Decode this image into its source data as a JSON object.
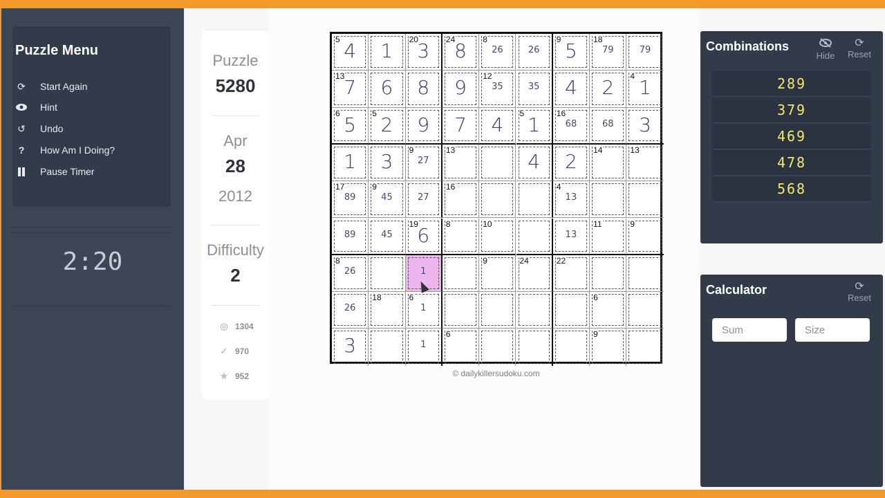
{
  "menu": {
    "title": "Puzzle Menu",
    "items": [
      {
        "label": "Start Again",
        "icon": "refresh-icon"
      },
      {
        "label": "Hint",
        "icon": "eye-icon"
      },
      {
        "label": "Undo",
        "icon": "undo-icon"
      },
      {
        "label": "How Am I Doing?",
        "icon": "question-icon"
      },
      {
        "label": "Pause Timer",
        "icon": "pause-icon"
      }
    ]
  },
  "timer": "2:20",
  "info": {
    "puzzle_label": "Puzzle",
    "puzzle_number": "5280",
    "month": "Apr",
    "day": "28",
    "year": "2012",
    "difficulty_label": "Difficulty",
    "difficulty": "2",
    "stats": [
      {
        "icon": "target-icon",
        "value": "1304"
      },
      {
        "icon": "check-icon",
        "value": "970"
      },
      {
        "icon": "star-icon",
        "value": "952"
      }
    ]
  },
  "grid": {
    "rows": [
      [
        "4",
        "1",
        "3",
        "8",
        "26",
        "26",
        "5",
        "79",
        "79"
      ],
      [
        "7",
        "6",
        "8",
        "9",
        "35",
        "35",
        "4",
        "2",
        "1"
      ],
      [
        "5",
        "2",
        "9",
        "7",
        "4",
        "1",
        "68",
        "68",
        "3"
      ],
      [
        "1",
        "3",
        "27",
        "",
        "",
        "4",
        "2",
        "",
        ""
      ],
      [
        "89",
        "45",
        "27",
        "",
        "",
        "",
        "13",
        "",
        ""
      ],
      [
        "89",
        "45",
        "6",
        "",
        "",
        "",
        "13",
        "",
        ""
      ],
      [
        "26",
        "",
        "1",
        "",
        "",
        "",
        "",
        "",
        ""
      ],
      [
        "26",
        "",
        "1",
        "",
        "",
        "",
        "",
        "",
        ""
      ],
      [
        "3",
        "",
        "1",
        "",
        "",
        "",
        "",
        "",
        ""
      ]
    ],
    "candidate_cells": [
      "0,4",
      "0,5",
      "0,7",
      "0,8",
      "1,4",
      "1,5",
      "2,6",
      "2,7",
      "3,2",
      "4,0",
      "4,1",
      "4,2",
      "4,6",
      "5,0",
      "5,1",
      "5,6",
      "6,0",
      "6,2",
      "7,0",
      "7,2",
      "8,2"
    ],
    "cage_sums": [
      {
        "cell": "0,0",
        "sum": "5"
      },
      {
        "cell": "0,2",
        "sum": "20"
      },
      {
        "cell": "0,3",
        "sum": "24"
      },
      {
        "cell": "0,4",
        "sum": "8"
      },
      {
        "cell": "0,6",
        "sum": "9"
      },
      {
        "cell": "0,7",
        "sum": "18"
      },
      {
        "cell": "1,0",
        "sum": "13"
      },
      {
        "cell": "1,4",
        "sum": "12"
      },
      {
        "cell": "1,8",
        "sum": "4"
      },
      {
        "cell": "2,0",
        "sum": "6"
      },
      {
        "cell": "2,1",
        "sum": "5"
      },
      {
        "cell": "2,5",
        "sum": "5"
      },
      {
        "cell": "2,6",
        "sum": "16"
      },
      {
        "cell": "3,2",
        "sum": "9"
      },
      {
        "cell": "3,3",
        "sum": "13"
      },
      {
        "cell": "3,7",
        "sum": "14"
      },
      {
        "cell": "3,8",
        "sum": "13"
      },
      {
        "cell": "4,0",
        "sum": "17"
      },
      {
        "cell": "4,1",
        "sum": "9"
      },
      {
        "cell": "4,3",
        "sum": "16"
      },
      {
        "cell": "4,6",
        "sum": "4"
      },
      {
        "cell": "5,2",
        "sum": "19"
      },
      {
        "cell": "5,3",
        "sum": "8"
      },
      {
        "cell": "5,4",
        "sum": "10"
      },
      {
        "cell": "5,7",
        "sum": "11"
      },
      {
        "cell": "5,8",
        "sum": "9"
      },
      {
        "cell": "6,0",
        "sum": "8"
      },
      {
        "cell": "6,4",
        "sum": "9"
      },
      {
        "cell": "6,5",
        "sum": "24"
      },
      {
        "cell": "6,6",
        "sum": "22"
      },
      {
        "cell": "7,1",
        "sum": "18"
      },
      {
        "cell": "7,2",
        "sum": "6"
      },
      {
        "cell": "7,7",
        "sum": "6"
      },
      {
        "cell": "8,3",
        "sum": "6"
      },
      {
        "cell": "8,7",
        "sum": "9"
      }
    ],
    "highlighted_cell": "6,2",
    "highlight_color": "#eeb6ee"
  },
  "copyright": "© dailykillersudoku.com",
  "combinations": {
    "title": "Combinations",
    "hide_label": "Hide",
    "reset_label": "Reset",
    "items": [
      "289",
      "379",
      "469",
      "478",
      "568"
    ]
  },
  "calculator": {
    "title": "Calculator",
    "reset_label": "Reset",
    "sum_placeholder": "Sum",
    "size_placeholder": "Size"
  },
  "colors": {
    "frame": "#f39a2f",
    "sidebar": "#3b4556",
    "panel": "#323b4a",
    "combo_text": "#f4e86b"
  }
}
